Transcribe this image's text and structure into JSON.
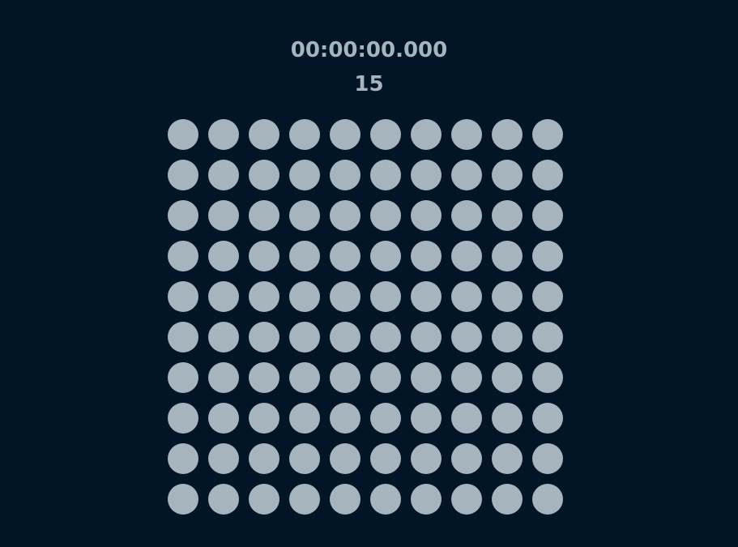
{
  "timer": "00:00:00.000",
  "counter": "15",
  "grid": {
    "rows": 10,
    "cols": 10,
    "dot_state": "inactive"
  },
  "colors": {
    "background": "#021527",
    "text": "#a6b4bd",
    "dot": "#a6b4bd"
  }
}
